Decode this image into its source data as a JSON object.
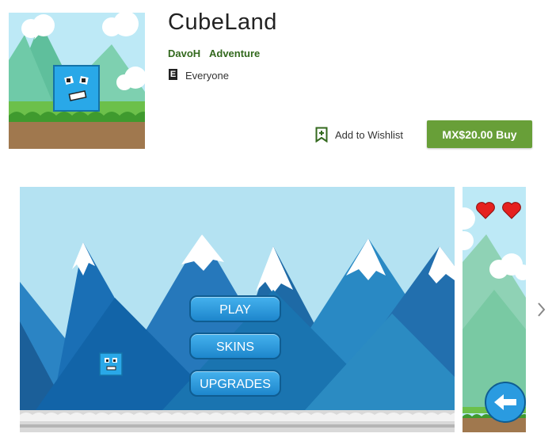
{
  "app": {
    "title": "CubeLand",
    "developer": "DavoH",
    "category": "Adventure",
    "content_rating_badge": "E",
    "content_rating": "Everyone"
  },
  "actions": {
    "wishlist_label": "Add to Wishlist",
    "buy_label": "MX$20.00 Buy",
    "buy_color": "#689f38"
  },
  "screenshots": {
    "game_menu": [
      "PLAY",
      "SKINS",
      "UPGRADES"
    ],
    "lives": 2
  },
  "icons": [
    "app-icon",
    "content-rating-icon",
    "wishlist-icon",
    "heart-icon",
    "back-arrow-icon",
    "chevron-right-icon"
  ]
}
